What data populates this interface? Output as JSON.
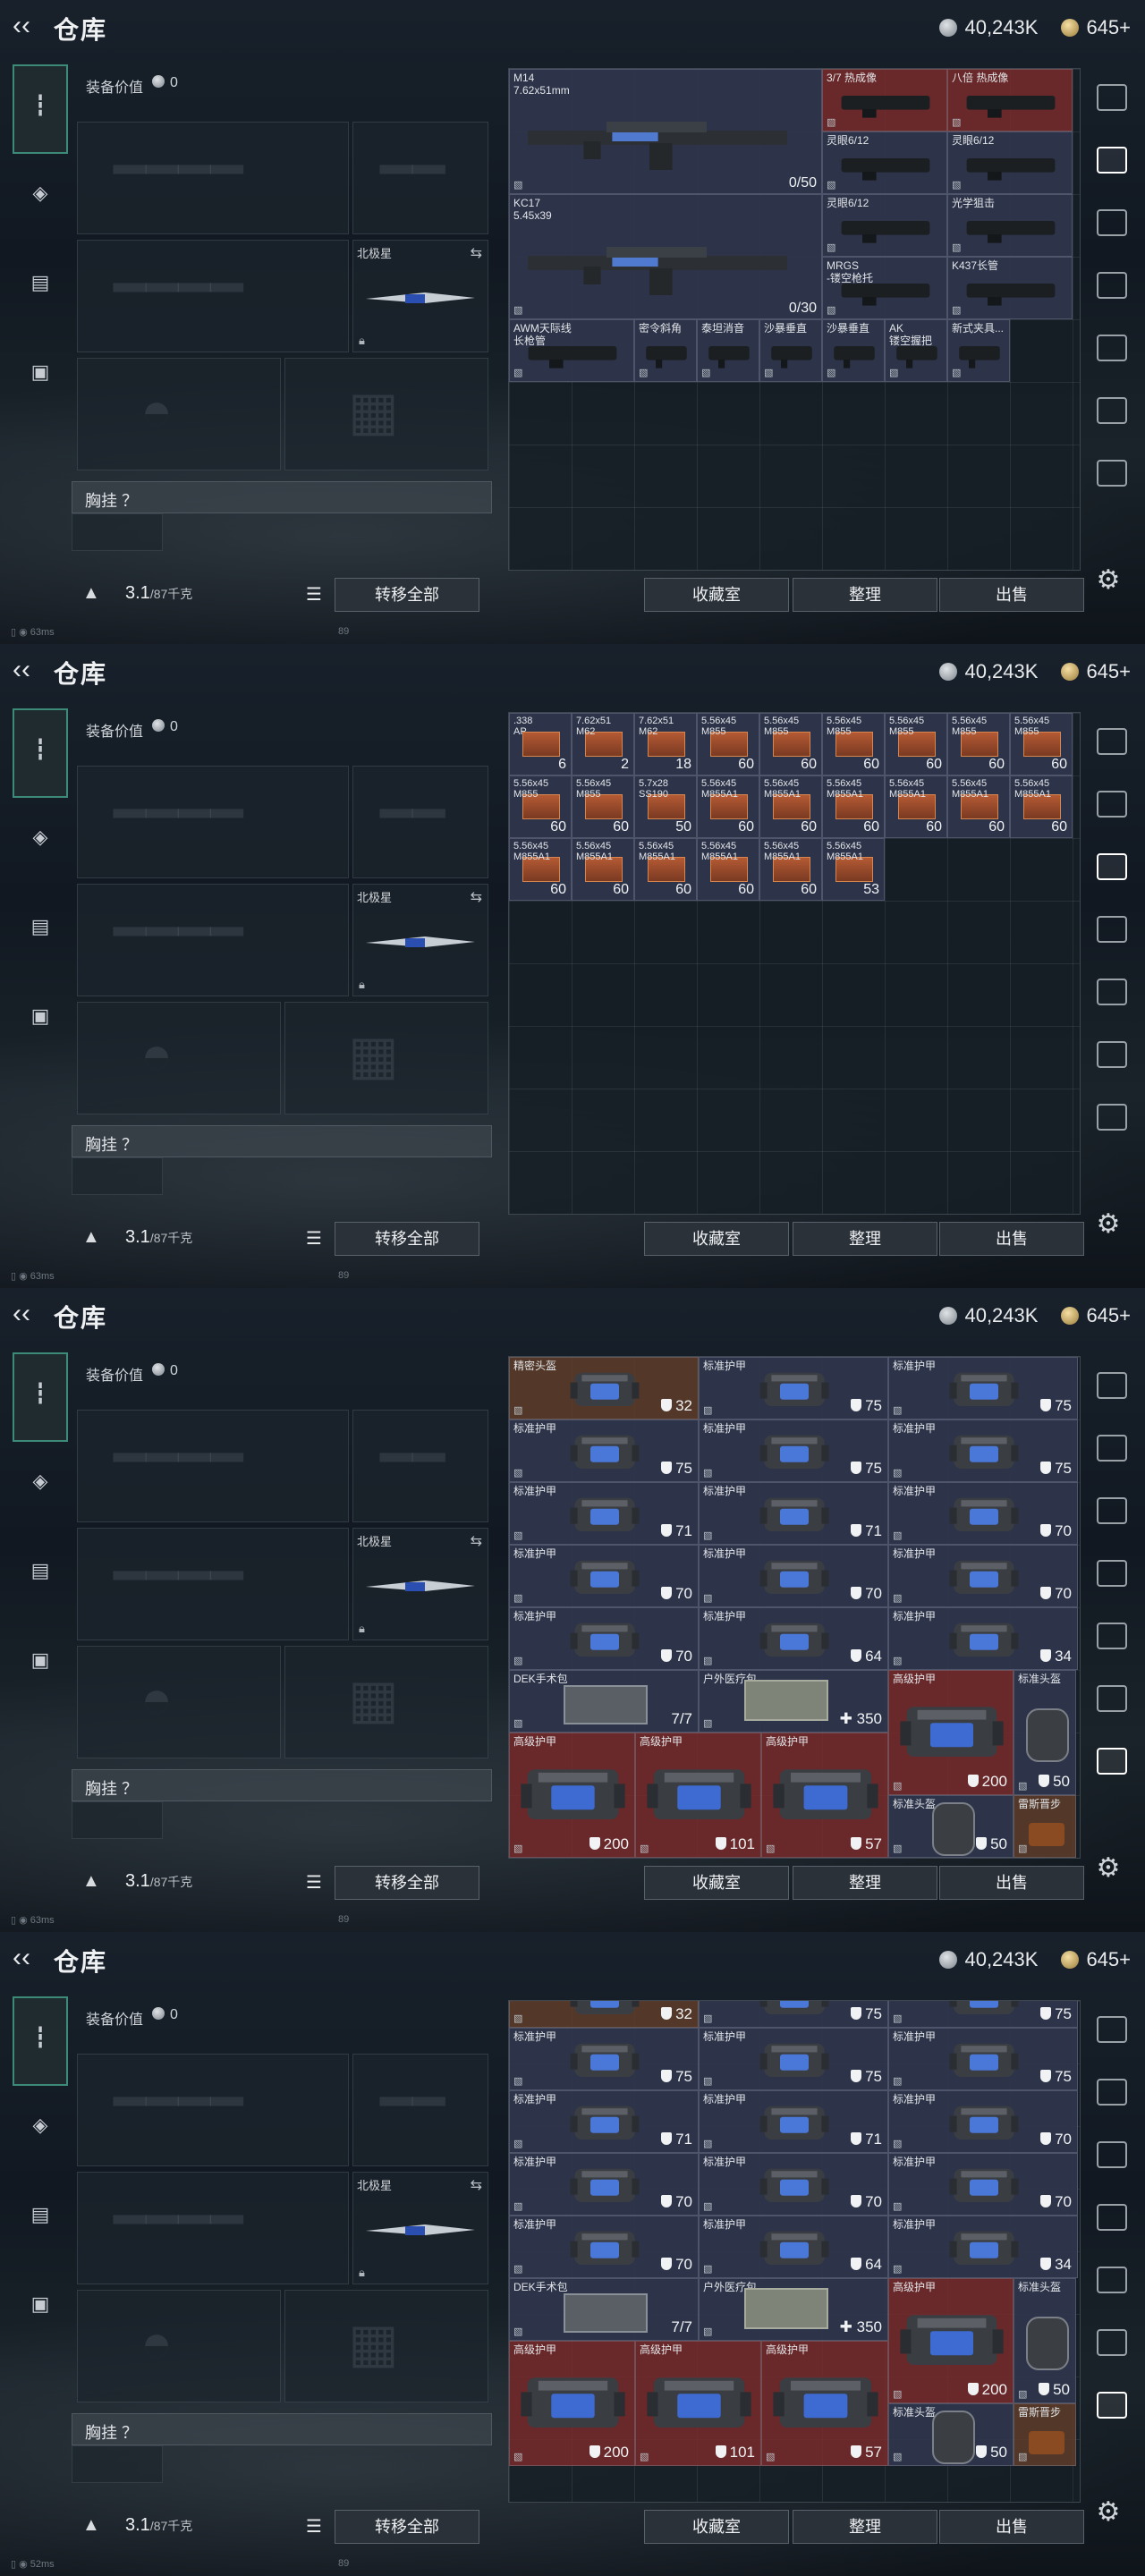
{
  "header": {
    "title": "仓库",
    "silver": "40,243K",
    "gold": "645+"
  },
  "loadout": {
    "value_label": "装备价值",
    "value": "0",
    "pet_label": "北极星",
    "chest_label": "胸挂 ？",
    "weight": "3.1",
    "weight_max": "/87千克",
    "transfer_label": "转移全部"
  },
  "storage_buttons": {
    "collect": "收藏室",
    "sort": "整理",
    "sell": "出售"
  },
  "status": {
    "wifi": "63ms",
    "fps": "89",
    "wifi_last": "52ms"
  },
  "panels": [
    {
      "items": [
        {
          "name": "M14\n7.62x51mm",
          "count": "0/50"
        },
        {
          "name": "KC17\n5.45x39",
          "count": "0/30"
        },
        {
          "name": "3/7 热成像"
        },
        {
          "name": "八倍 热成像"
        },
        {
          "name": "灵眼6/12"
        },
        {
          "name": "灵眼6/12"
        },
        {
          "name": "灵眼6/12"
        },
        {
          "name": "光学狙击"
        },
        {
          "name": "MRGS\n-镂空枪托"
        },
        {
          "name": "K437长管"
        },
        {
          "name": "AWM天际线\n长枪管"
        },
        {
          "name": "密令斜角"
        },
        {
          "name": "泰坦消音"
        },
        {
          "name": "沙暴垂直"
        },
        {
          "name": "沙暴垂直"
        },
        {
          "name": "AK\n镂空握把"
        },
        {
          "name": "新式夹具..."
        }
      ]
    },
    {
      "ammo": [
        {
          "name": ".338\nAP",
          "count": "6"
        },
        {
          "name": "7.62x51\nM62",
          "count": "2"
        },
        {
          "name": "7.62x51\nM62",
          "count": "18"
        },
        {
          "name": "5.56x45\nM855",
          "count": "60"
        },
        {
          "name": "5.56x45\nM855",
          "count": "60"
        },
        {
          "name": "5.56x45\nM855",
          "count": "60"
        },
        {
          "name": "5.56x45\nM855",
          "count": "60"
        },
        {
          "name": "5.56x45\nM855",
          "count": "60"
        },
        {
          "name": "5.56x45\nM855",
          "count": "60"
        },
        {
          "name": "5.56x45\nM855",
          "count": "60"
        },
        {
          "name": "5.56x45\nM855",
          "count": "60"
        },
        {
          "name": "5.7x28\nSS190",
          "count": "50"
        },
        {
          "name": "5.56x45\nM855A1",
          "count": "60"
        },
        {
          "name": "5.56x45\nM855A1",
          "count": "60"
        },
        {
          "name": "5.56x45\nM855A1",
          "count": "60"
        },
        {
          "name": "5.56x45\nM855A1",
          "count": "60"
        },
        {
          "name": "5.56x45\nM855A1",
          "count": "60"
        },
        {
          "name": "5.56x45\nM855A1",
          "count": "60"
        },
        {
          "name": "5.56x45\nM855A1",
          "count": "60"
        },
        {
          "name": "5.56x45\nM855A1",
          "count": "60"
        },
        {
          "name": "5.56x45\nM855A1",
          "count": "60"
        },
        {
          "name": "5.56x45\nM855A1",
          "count": "60"
        },
        {
          "name": "5.56x45\nM855A1",
          "count": "60"
        },
        {
          "name": "5.56x45\nM855A1",
          "count": "53"
        }
      ]
    },
    {
      "armor": [
        {
          "name": "精密头盔",
          "value": "32"
        },
        {
          "name": "标准护甲",
          "value": "75"
        },
        {
          "name": "标准护甲",
          "value": "75"
        },
        {
          "name": "标准护甲",
          "value": "75"
        },
        {
          "name": "标准护甲",
          "value": "75"
        },
        {
          "name": "标准护甲",
          "value": "75"
        },
        {
          "name": "标准护甲",
          "value": "71"
        },
        {
          "name": "标准护甲",
          "value": "71"
        },
        {
          "name": "标准护甲",
          "value": "70"
        },
        {
          "name": "标准护甲",
          "value": "70"
        },
        {
          "name": "标准护甲",
          "value": "70"
        },
        {
          "name": "标准护甲",
          "value": "70"
        },
        {
          "name": "标准护甲",
          "value": "70"
        },
        {
          "name": "标准护甲",
          "value": "64"
        },
        {
          "name": "标准护甲",
          "value": "34"
        }
      ],
      "special": [
        {
          "name": "DEK手术包",
          "value": "7/7"
        },
        {
          "name": "户外医疗包",
          "value": "350"
        },
        {
          "name": "高级护甲",
          "value": "200"
        },
        {
          "name": "标准头盔",
          "value": "50"
        },
        {
          "name": "高级护甲",
          "value": "200"
        },
        {
          "name": "高级护甲",
          "value": "101"
        },
        {
          "name": "高级护甲",
          "value": "57"
        },
        {
          "name": "标准头盔",
          "value": "50"
        },
        {
          "name": "雷斯晋步"
        }
      ]
    }
  ]
}
